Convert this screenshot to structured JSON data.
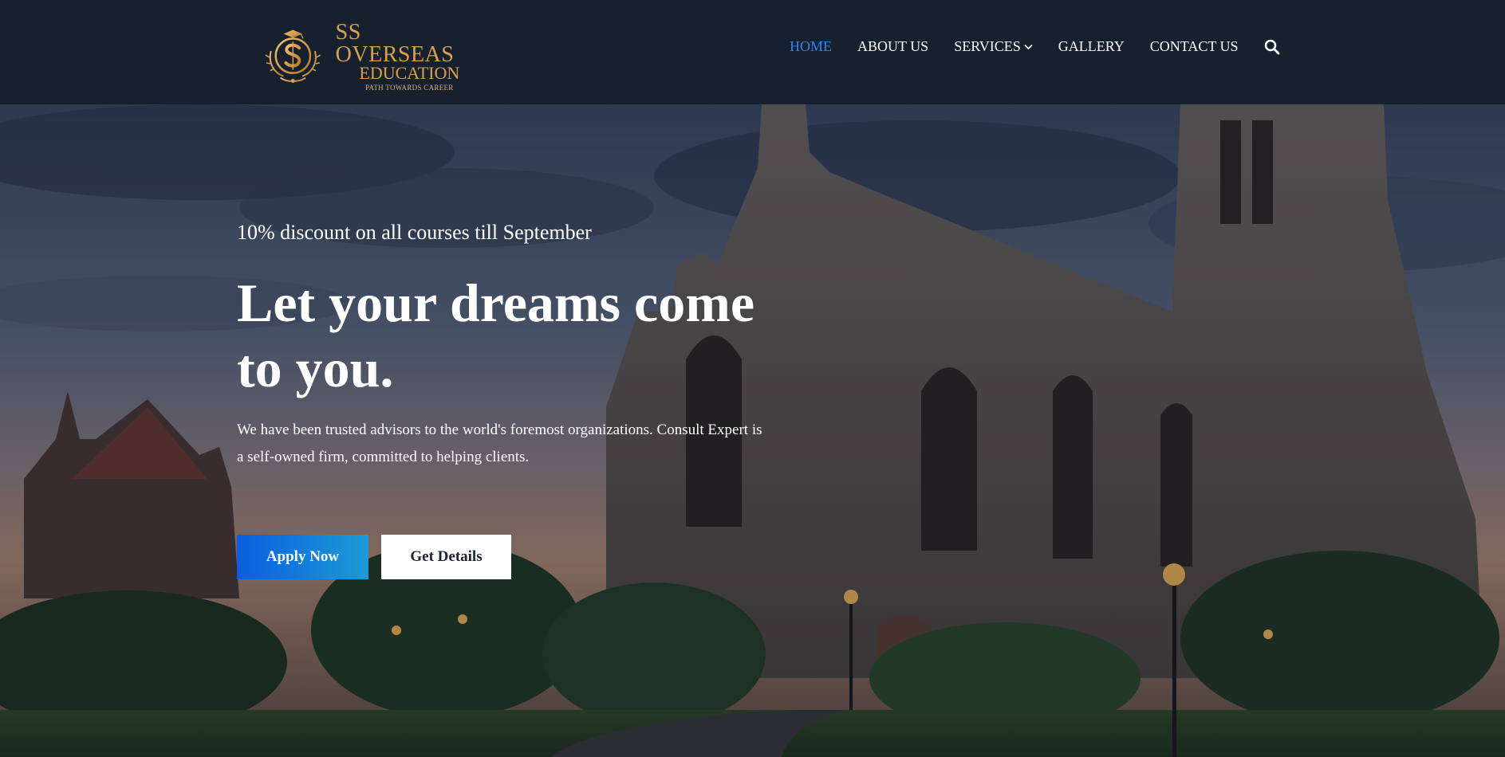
{
  "brand": {
    "line1": "SS OVERSEAS",
    "line2": "EDUCATION",
    "tagline": "PATH TOWARDS CAREER"
  },
  "nav": {
    "items": [
      {
        "label": "HOME",
        "active": true
      },
      {
        "label": "ABOUT US",
        "active": false
      },
      {
        "label": "SERVICES",
        "active": false,
        "has_dropdown": true
      },
      {
        "label": "GALLERY",
        "active": false
      },
      {
        "label": "CONTACT US",
        "active": false
      }
    ],
    "search_icon": "search-icon",
    "dropdown_icon": "chevron-down-icon"
  },
  "hero": {
    "promo": "10% discount on all courses till September",
    "headline": "Let your dreams come to you.",
    "description": "We have been trusted advisors to the world's foremost organizations. Consult Expert is a self-owned firm, committed to helping clients.",
    "primary_button": "Apply Now",
    "secondary_button": "Get Details"
  },
  "colors": {
    "navbar_bg": "#16202f",
    "active_nav": "#2f86e8",
    "brand_gold": "#d9a14a",
    "apply_gradient_start": "#0b5ee0",
    "apply_gradient_end": "#1c9bd6"
  }
}
